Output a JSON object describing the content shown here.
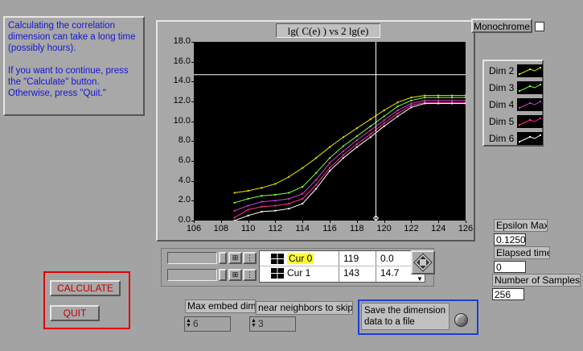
{
  "note_text": "Calculating the correlation dimension can take a long time (possibly hours).\n\nIf you want to continue, press the \"Calculate\" button. Otherwise, press \"Quit.\"",
  "monochrome_label": "Monochrome",
  "chart_data": {
    "type": "line",
    "title": "lg( C(e) )  vs 2 lg(e)",
    "xlim": [
      106,
      126
    ],
    "ylim": [
      0,
      18
    ],
    "x_ticks": [
      "106",
      "108",
      "110",
      "112",
      "114",
      "116",
      "118",
      "120",
      "122",
      "124",
      "126"
    ],
    "y_ticks": [
      "0.0",
      "2.0",
      "4.0",
      "6.0",
      "8.0",
      "10.0",
      "12.0",
      "14.0",
      "16.0",
      "18.0"
    ],
    "x": [
      109,
      110,
      111,
      112,
      113,
      114,
      115,
      116,
      117,
      118,
      119,
      120,
      121,
      122,
      123,
      124,
      125,
      126
    ],
    "series": [
      {
        "name": "Dim 2",
        "color": "#e6e600",
        "values": [
          2.8,
          3.0,
          3.3,
          3.7,
          4.4,
          5.3,
          6.3,
          7.4,
          8.4,
          9.3,
          10.2,
          11.1,
          11.9,
          12.4,
          12.6,
          12.6,
          12.6,
          12.6
        ]
      },
      {
        "name": "Dim 3",
        "color": "#80ff40",
        "values": [
          1.8,
          2.2,
          2.5,
          2.6,
          2.8,
          3.4,
          4.8,
          6.3,
          7.5,
          8.5,
          9.5,
          10.5,
          11.5,
          12.1,
          12.4,
          12.4,
          12.4,
          12.4
        ]
      },
      {
        "name": "Dim 4",
        "color": "#d040d0",
        "values": [
          1.0,
          1.5,
          1.9,
          2.0,
          2.2,
          2.7,
          4.1,
          5.8,
          7.0,
          8.1,
          9.1,
          10.1,
          11.1,
          11.8,
          12.1,
          12.1,
          12.1,
          12.1
        ]
      },
      {
        "name": "Dim 5",
        "color": "#ff3090",
        "values": [
          0.3,
          1.1,
          1.4,
          1.5,
          1.7,
          2.2,
          3.6,
          5.3,
          6.6,
          7.7,
          8.7,
          9.8,
          10.8,
          11.6,
          11.9,
          11.9,
          11.9,
          11.9
        ]
      },
      {
        "name": "Dim 6",
        "color": "#ffffff",
        "values": [
          0.0,
          0.5,
          0.9,
          1.0,
          1.2,
          1.7,
          3.2,
          5.0,
          6.3,
          7.4,
          8.4,
          9.5,
          10.5,
          11.4,
          11.8,
          11.8,
          11.8,
          11.8
        ]
      }
    ],
    "cursor": {
      "x": 119.4,
      "y": 14.7
    }
  },
  "legend": [
    "Dim 2",
    "Dim 3",
    "Dim 4",
    "Dim 5",
    "Dim 6"
  ],
  "cursors": [
    {
      "name": "Cur 0",
      "x": "119",
      "y": "0.0"
    },
    {
      "name": "Cur 1",
      "x": "143",
      "y": "14.7"
    }
  ],
  "buttons": {
    "calculate": "CALCULATE",
    "quit": "QUIT"
  },
  "fields": {
    "max_embed_label": "Max embed dim",
    "max_embed_value": "6",
    "near_neighbors_label": "near neighbors to skip",
    "near_neighbors_value": "3",
    "epsilon_label": "Epsilon Max",
    "epsilon_value": "0.1250",
    "elapsed_label": "Elapsed time",
    "elapsed_value": "0",
    "samples_label": "Number of Samples",
    "samples_value": "256"
  },
  "save_label": "Save the dimension data to a file"
}
